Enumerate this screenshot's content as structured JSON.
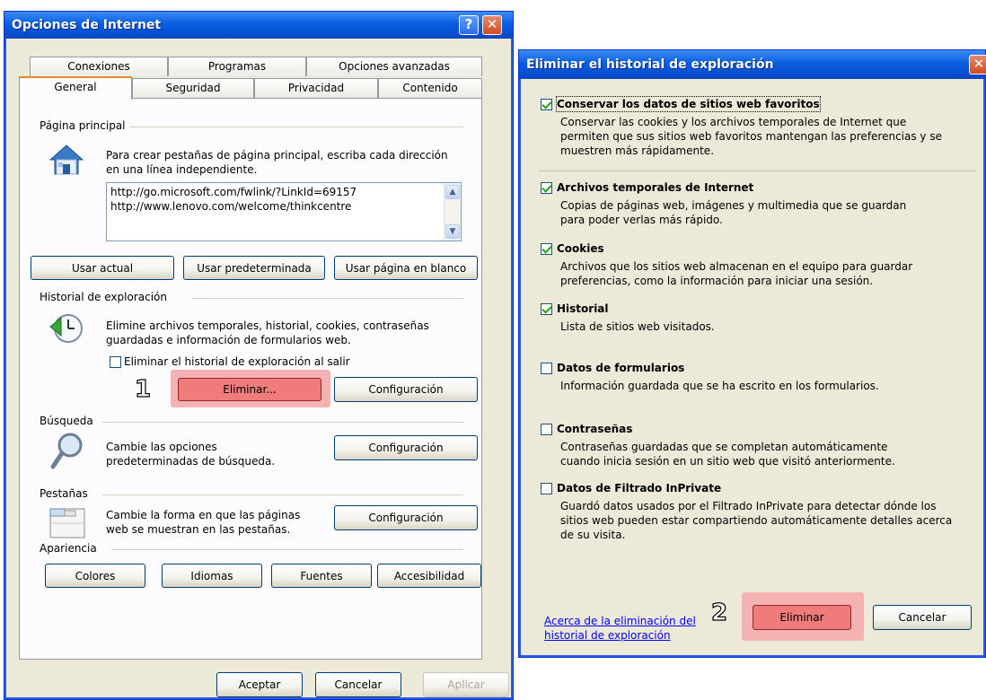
{
  "left_window": {
    "title": "Opciones de Internet",
    "help_glyph": "?",
    "close_glyph": "✕",
    "tabs_row1": [
      "Conexiones",
      "Programas",
      "Opciones avanzadas"
    ],
    "tabs_row2": [
      "General",
      "Seguridad",
      "Privacidad",
      "Contenido"
    ],
    "homepage": {
      "section": "Página principal",
      "desc_line1": "Para crear pestañas de página principal, escriba cada dirección",
      "desc_line2": "en una línea independiente.",
      "url1": "http://go.microsoft.com/fwlink/?LinkId=69157",
      "url2": "http://www.lenovo.com/welcome/thinkcentre",
      "btn_current": "Usar actual",
      "btn_default": "Usar predeterminada",
      "btn_blank": "Usar página en blanco"
    },
    "history": {
      "section": "Historial de exploración",
      "desc_line1": "Elimine archivos temporales, historial, cookies, contraseñas",
      "desc_line2": "guardadas e información de formularios web.",
      "checkbox_label": "Eliminar el historial de exploración al salir",
      "step_number": "1",
      "btn_delete": "Eliminar...",
      "btn_config": "Configuración"
    },
    "search": {
      "section": "Búsqueda",
      "desc_line1": "Cambie las opciones",
      "desc_line2": "predeterminadas de búsqueda.",
      "btn_config": "Configuración"
    },
    "tabs_section": {
      "section": "Pestañas",
      "desc_line1": "Cambie la forma en que las páginas",
      "desc_line2": "web se muestran en las pestañas.",
      "btn_config": "Configuración"
    },
    "appearance": {
      "section": "Apariencia",
      "btn_colors": "Colores",
      "btn_languages": "Idiomas",
      "btn_fonts": "Fuentes",
      "btn_accessibility": "Accesibilidad"
    },
    "footer": {
      "btn_ok": "Aceptar",
      "btn_cancel": "Cancelar",
      "btn_apply": "Aplicar"
    }
  },
  "right_window": {
    "title": "Eliminar el historial de exploración",
    "close_glyph": "✕",
    "options": [
      {
        "label": "Conservar los datos de sitios web favoritos",
        "checked": true,
        "desc": [
          "Conservar las cookies y los archivos temporales de Internet que",
          "permiten que sus sitios web favoritos mantengan las preferencias y se",
          "muestren más rápidamente."
        ]
      },
      {
        "label": "Archivos temporales de Internet",
        "checked": true,
        "desc": [
          "Copias de páginas web, imágenes y multimedia que se guardan",
          "para poder verlas más rápido."
        ]
      },
      {
        "label": "Cookies",
        "checked": true,
        "desc": [
          "Archivos que los sitios web almacenan en el equipo para guardar",
          "preferencias, como la información para iniciar una sesión."
        ]
      },
      {
        "label": "Historial",
        "checked": true,
        "desc": [
          "Lista de sitios web visitados."
        ]
      },
      {
        "label": "Datos de formularios",
        "checked": false,
        "desc": [
          "Información guardada que se ha escrito en los formularios."
        ]
      },
      {
        "label": "Contraseñas",
        "checked": false,
        "desc": [
          "Contraseñas guardadas que se completan automáticamente",
          "cuando inicia sesión en un sitio web que visitó anteriormente."
        ]
      },
      {
        "label": "Datos de Filtrado InPrivate",
        "checked": false,
        "desc": [
          "Guardó datos usados por el Filtrado InPrivate para detectar dónde los",
          "sitios web pueden estar compartiendo automáticamente detalles acerca",
          "de su visita."
        ]
      }
    ],
    "link_line1": "Acerca de la eliminación del",
    "link_line2": "historial de exploración",
    "step_number": "2",
    "btn_delete": "Eliminar",
    "btn_cancel": "Cancelar"
  }
}
